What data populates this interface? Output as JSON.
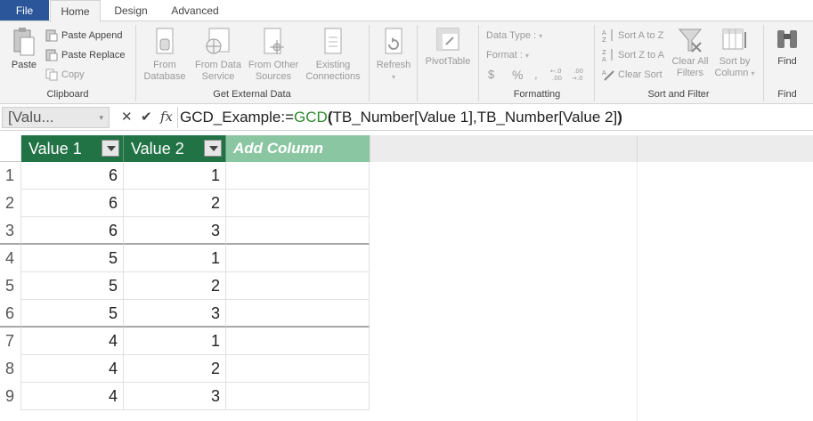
{
  "tabs": {
    "file": "File",
    "home": "Home",
    "design": "Design",
    "advanced": "Advanced"
  },
  "ribbon": {
    "clipboard": {
      "paste": "Paste",
      "paste_append": "Paste Append",
      "paste_replace": "Paste Replace",
      "copy": "Copy",
      "label": "Clipboard"
    },
    "external": {
      "from_database": [
        "From",
        "Database"
      ],
      "from_data_service": [
        "From Data",
        "Service"
      ],
      "from_other_sources": [
        "From Other",
        "Sources"
      ],
      "existing_connections": [
        "Existing",
        "Connections"
      ],
      "label": "Get External Data"
    },
    "refresh": "Refresh",
    "pivottable": "PivotTable",
    "formatting": {
      "data_type": "Data Type :",
      "format": "Format :",
      "currency": "$",
      "percent": "%",
      "comma": "͉",
      "inc_decimal": "→.0\n.00",
      "dec_decimal": ".00\n→.0",
      "label": "Formatting"
    },
    "sort_filter": {
      "sort_a_z": "Sort A to Z",
      "sort_z_a": "Sort Z to A",
      "clear_sort": "Clear Sort",
      "clear_all_filters": [
        "Clear All",
        "Filters"
      ],
      "sort_by_column": [
        "Sort by",
        "Column"
      ],
      "label": "Sort and Filter"
    },
    "find": {
      "find": "Find",
      "label": "Find"
    }
  },
  "formula_bar": {
    "name_box": "[Valu...",
    "cancel": "✕",
    "enter": "✔",
    "fx": "fx",
    "measure_name": "GCD_Example:=",
    "function": "GCD",
    "open_paren": "(",
    "args": "TB_Number[Value 1],TB_Number[Value 2]",
    "close_paren": ")"
  },
  "table": {
    "columns": [
      "Value 1",
      "Value 2"
    ],
    "add_column": "Add Column",
    "rows": [
      {
        "n": "1",
        "v1": "6",
        "v2": "1"
      },
      {
        "n": "2",
        "v1": "6",
        "v2": "2"
      },
      {
        "n": "3",
        "v1": "6",
        "v2": "3"
      },
      {
        "n": "4",
        "v1": "5",
        "v2": "1"
      },
      {
        "n": "5",
        "v1": "5",
        "v2": "2"
      },
      {
        "n": "6",
        "v1": "5",
        "v2": "3"
      },
      {
        "n": "7",
        "v1": "4",
        "v2": "1"
      },
      {
        "n": "8",
        "v1": "4",
        "v2": "2"
      },
      {
        "n": "9",
        "v1": "4",
        "v2": "3"
      }
    ]
  },
  "colors": {
    "file_tab": "#2b579a",
    "header_green": "#217346",
    "add_column_green": "#8bc6a2",
    "function_green": "#2d8a2d"
  }
}
